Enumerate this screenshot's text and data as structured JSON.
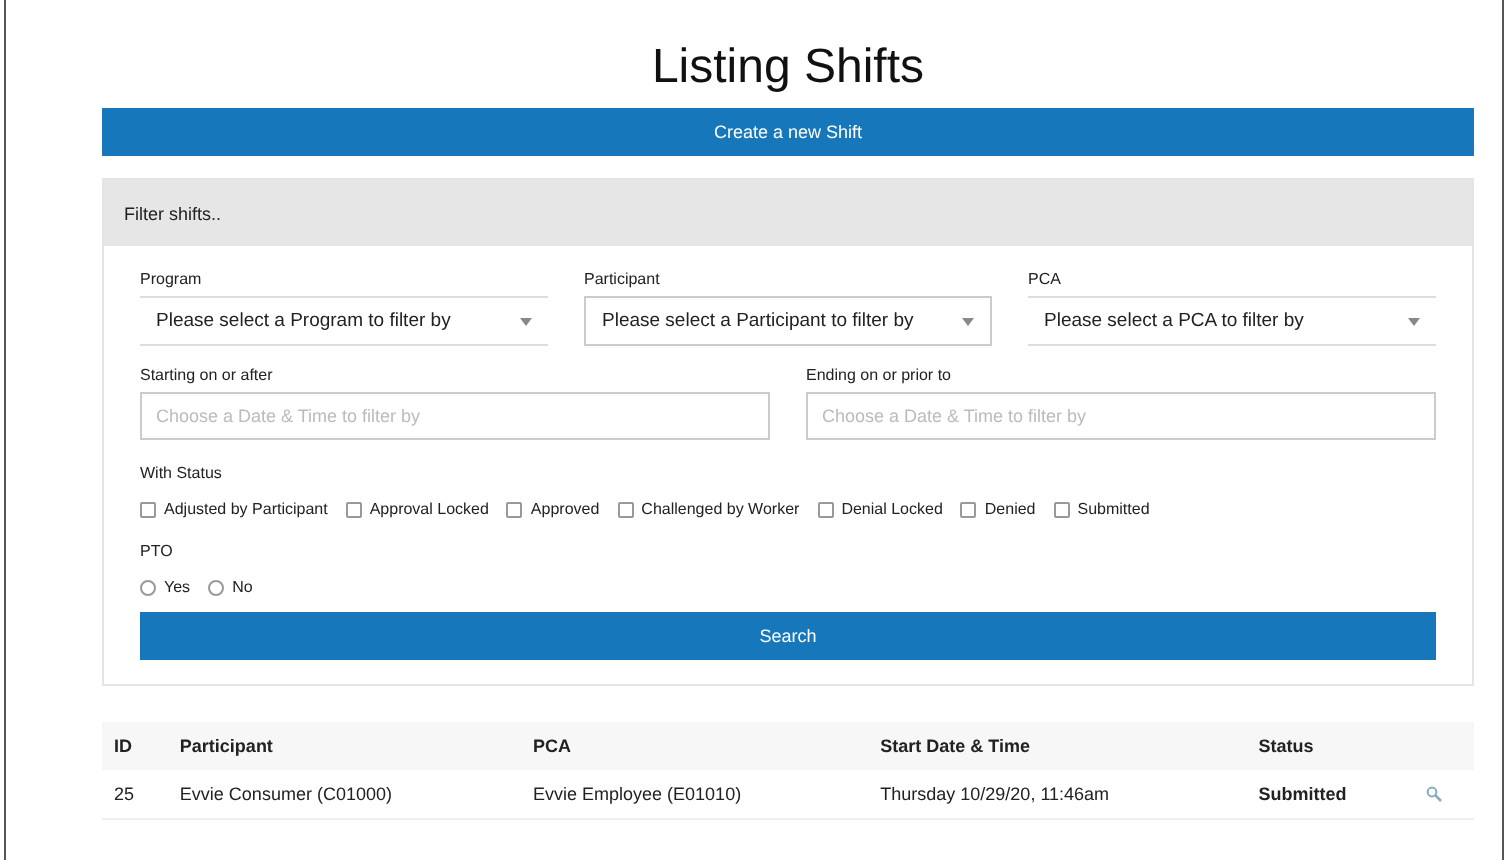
{
  "title": "Listing Shifts",
  "create_button": "Create a new Shift",
  "filter": {
    "header": "Filter shifts..",
    "selects": [
      {
        "label": "Program",
        "placeholder": "Please select a Program to filter by"
      },
      {
        "label": "Participant",
        "placeholder": "Please select a Participant to filter by"
      },
      {
        "label": "PCA",
        "placeholder": "Please select a PCA to filter by"
      }
    ],
    "dates": [
      {
        "label": "Starting on or after",
        "placeholder": "Choose a Date & Time to filter by"
      },
      {
        "label": "Ending on or prior to",
        "placeholder": "Choose a Date & Time to filter by"
      }
    ],
    "status_label": "With Status",
    "statuses": [
      {
        "label": "Adjusted by Participant",
        "checked": false
      },
      {
        "label": "Approval Locked",
        "checked": false
      },
      {
        "label": "Approved",
        "checked": false
      },
      {
        "label": "Challenged by Worker",
        "checked": false
      },
      {
        "label": "Denial Locked",
        "checked": false
      },
      {
        "label": "Denied",
        "checked": false
      },
      {
        "label": "Submitted",
        "checked": false
      }
    ],
    "pto_label": "PTO",
    "pto_options": [
      {
        "label": "Yes",
        "selected": false
      },
      {
        "label": "No",
        "selected": false
      }
    ],
    "search_button": "Search"
  },
  "table": {
    "columns": [
      "ID",
      "Participant",
      "PCA",
      "Start Date & Time",
      "Status"
    ],
    "rows": [
      {
        "cells": [
          "25",
          "Evvie Consumer (C01000)",
          "Evvie Employee (E01010)",
          "Thursday 10/29/20, 11:46am",
          "Submitted"
        ]
      }
    ]
  }
}
